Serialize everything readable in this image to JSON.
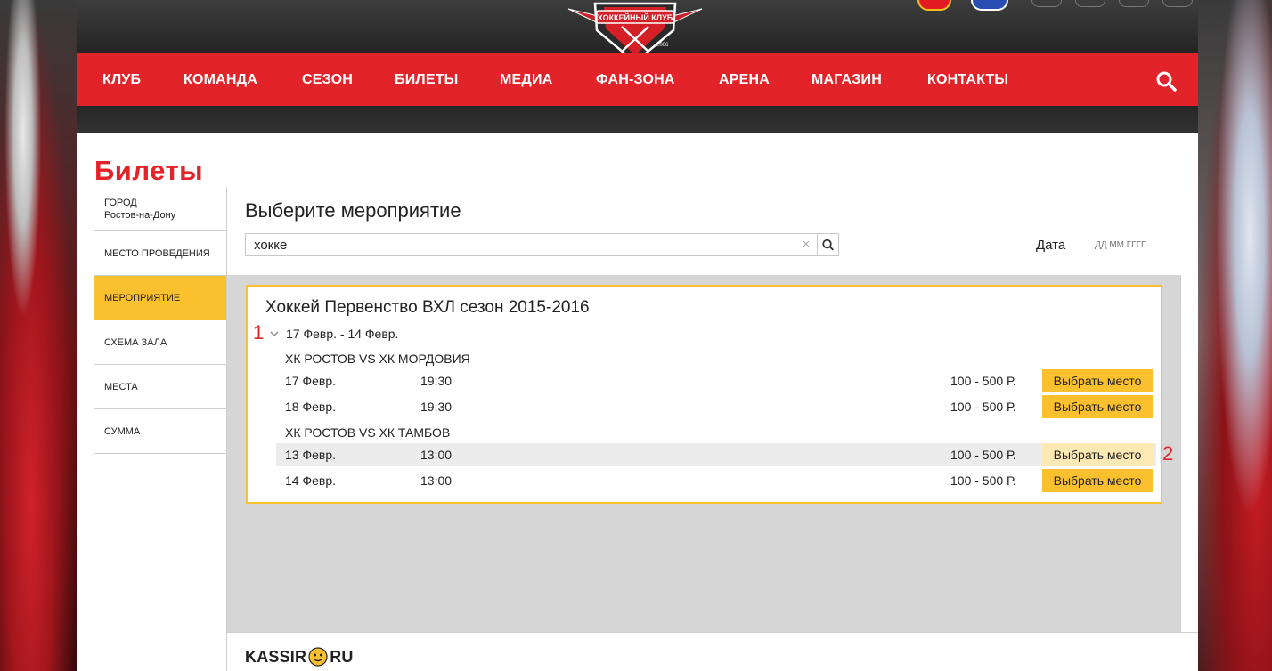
{
  "header": {
    "logo_subtitle": "ХОККЕЙНЫЙ КЛУБ",
    "logo_year": "2006"
  },
  "nav": {
    "items": [
      "КЛУБ",
      "КОМАНДА",
      "СЕЗОН",
      "БИЛЕТЫ",
      "МЕДИА",
      "ФАН-ЗОНА",
      "АРЕНА",
      "МАГАЗИН",
      "КОНТАКТЫ"
    ],
    "search_icon": "search-icon"
  },
  "page": {
    "title": "Билеты"
  },
  "steps": [
    {
      "label": "ГОРОД",
      "value": "Ростов-на-Дону"
    },
    {
      "label": "МЕСТО ПРОВЕДЕНИЯ"
    },
    {
      "label": "МЕРОПРИЯТИЕ",
      "active": true
    },
    {
      "label": "СХЕМА ЗАЛА"
    },
    {
      "label": "МЕСТА"
    },
    {
      "label": "СУММА"
    }
  ],
  "content": {
    "title": "Выберите мероприятие",
    "search_value": "хокке",
    "clear_label": "×",
    "date_label": "Дата",
    "date_placeholder": "ДД.ММ.ГГГГ"
  },
  "event": {
    "title": "Хоккей Первенство ВХЛ сезон 2015-2016",
    "range": "17 Февр. - 14 Февр.",
    "annotation_1": "1",
    "annotation_2": "2",
    "groups": [
      {
        "match": "ХК РОСТОВ VS ХК МОРДОВИЯ",
        "sessions": [
          {
            "date": "17 Февр.",
            "time": "19:30",
            "price": "100 - 500 Р.",
            "button": "Выбрать место"
          },
          {
            "date": "18 Февр.",
            "time": "19:30",
            "price": "100 - 500 Р.",
            "button": "Выбрать место"
          }
        ]
      },
      {
        "match": "ХК РОСТОВ VS ХК ТАМБОВ",
        "sessions": [
          {
            "date": "13 Февр.",
            "time": "13:00",
            "price": "100 - 500 Р.",
            "button": "Выбрать место",
            "highlighted": true
          },
          {
            "date": "14 Февр.",
            "time": "13:00",
            "price": "100 - 500 Р.",
            "button": "Выбрать место"
          }
        ]
      }
    ]
  },
  "footer": {
    "logo_left": "KASSIR",
    "logo_right": "RU"
  },
  "colors": {
    "brand_red": "#e2232a",
    "accent_yellow": "#fbc02d",
    "highlight_row": "#ececec"
  }
}
